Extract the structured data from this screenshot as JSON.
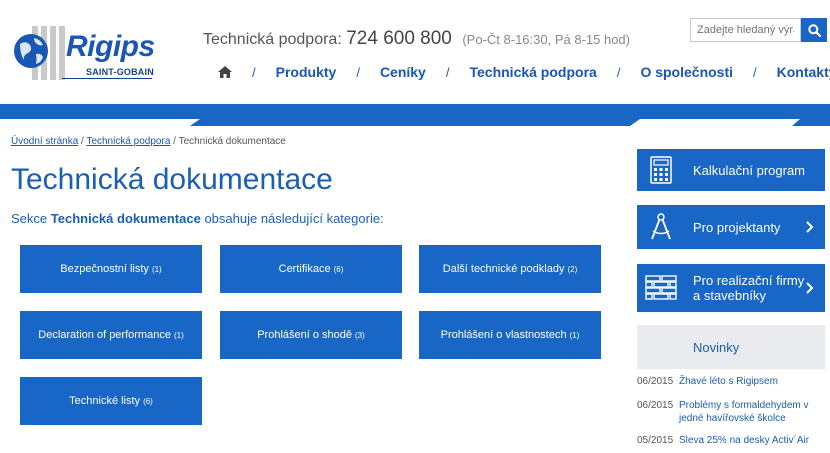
{
  "brand": {
    "logo_text": "Rigips",
    "logo_sub": "SAINT-GOBAIN",
    "primary_color": "#1866c6"
  },
  "header": {
    "support_label": "Technická podpora:",
    "support_phone": "724 600 800",
    "support_hours": "(Po-Čt 8-16:30, Pá 8-15 hod)",
    "search_placeholder": "Zadejte hledaný výraz",
    "search_icon": "search-icon",
    "nav": [
      {
        "label": "Produkty"
      },
      {
        "label": "Ceníky"
      },
      {
        "label": "Technická podpora"
      },
      {
        "label": "O společnosti"
      },
      {
        "label": "Kontakty"
      }
    ]
  },
  "breadcrumb": {
    "home": "Úvodní stránka",
    "parent": "Technická podpora",
    "current": "Technická dokumentace",
    "sep": "/"
  },
  "main": {
    "title": "Technická dokumentace",
    "intro_before": "Sekce",
    "intro_bold": "Technická dokumentace",
    "intro_after": "obsahuje následující kategorie:",
    "categories": [
      {
        "label": "Bezpečnostní listy",
        "count": "(1)"
      },
      {
        "label": "Certifikace",
        "count": "(6)"
      },
      {
        "label": "Další technické podklady",
        "count": "(2)"
      },
      {
        "label": "Declaration of performance",
        "count": "(1)"
      },
      {
        "label": "Prohlášení o shodě",
        "count": "(3)"
      },
      {
        "label": "Prohlášení o vlastnostech",
        "count": "(1)"
      },
      {
        "label": "Technické listy",
        "count": "(6)"
      }
    ]
  },
  "sidebar": {
    "buttons": [
      {
        "label": "Kalkulační program",
        "icon": "calculator-icon"
      },
      {
        "label": "Pro projektanty",
        "icon": "compass-icon"
      },
      {
        "label_line1": "Pro realizační firmy",
        "label_line2": "a stavebníky",
        "icon": "brick-wall-icon"
      }
    ],
    "news_heading": "Novinky",
    "news": [
      {
        "date": "06/2015",
        "title": "Žhavé léto s Rigipsem"
      },
      {
        "date": "06/2015",
        "title": "Problémy s formaldehydem v jedné havířovské školce"
      },
      {
        "date": "05/2015",
        "title": "Sleva 25% na desky Activ´Air"
      }
    ]
  }
}
